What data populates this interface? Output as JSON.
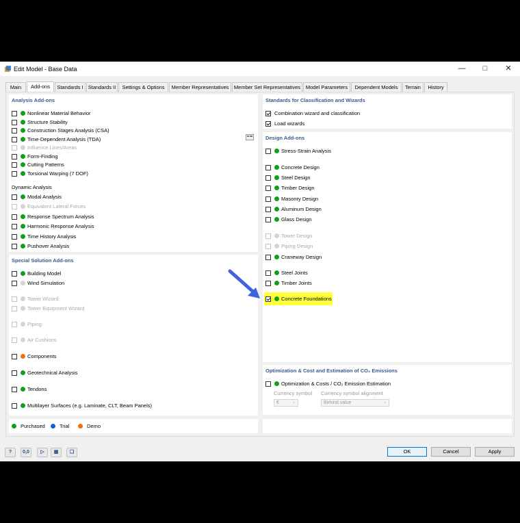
{
  "window": {
    "title": "Edit Model - Base Data"
  },
  "tabs": [
    "Main",
    "Add-ons",
    "Standards I",
    "Standards II",
    "Settings & Options",
    "Member Representatives",
    "Member Set Representatives",
    "Model Parameters",
    "Dependent Models",
    "Terrain",
    "History"
  ],
  "analysis": {
    "title": "Analysis Add-ons",
    "items": [
      {
        "label": "Nonlinear Material Behavior",
        "dot": "green",
        "disabled": false
      },
      {
        "label": "Structure Stability",
        "dot": "green",
        "disabled": false
      },
      {
        "label": "Construction Stages Analysis (CSA)",
        "dot": "green",
        "disabled": false
      },
      {
        "label": "Time-Dependent Analysis (TDA)",
        "dot": "green",
        "disabled": false
      },
      {
        "label": "Influence Lines/Areas",
        "dot": "gray",
        "disabled": true
      },
      {
        "label": "Form-Finding",
        "dot": "green",
        "disabled": false
      },
      {
        "label": "Cutting Patterns",
        "dot": "green",
        "disabled": false
      },
      {
        "label": "Torsional Warping (7 DOF)",
        "dot": "green",
        "disabled": false
      }
    ],
    "dynamic_title": "Dynamic Analysis",
    "dynamic_items": [
      {
        "label": "Modal Analysis",
        "dot": "green",
        "disabled": false
      },
      {
        "label": "Equivalent Lateral Forces",
        "dot": "gray",
        "disabled": true
      },
      {
        "label": "Response Spectrum Analysis",
        "dot": "green",
        "disabled": false
      },
      {
        "label": "Harmonic Response Analysis",
        "dot": "green",
        "disabled": false
      },
      {
        "label": "Time History Analysis",
        "dot": "green",
        "disabled": false
      },
      {
        "label": "Pushover Analysis",
        "dot": "green",
        "disabled": false
      }
    ]
  },
  "special": {
    "title": "Special Solution Add-ons",
    "items": [
      {
        "label": "Building Model",
        "dot": "green",
        "disabled": false
      },
      {
        "label": "Wind Simulation",
        "dot": "gray",
        "disabled": false
      },
      {
        "label": "Tower Wizard",
        "dot": "gray",
        "disabled": true
      },
      {
        "label": "Tower Equipment Wizard",
        "dot": "gray",
        "disabled": true
      },
      {
        "label": "Piping",
        "dot": "gray",
        "disabled": true
      },
      {
        "label": "Air Cushions",
        "dot": "gray",
        "disabled": true
      },
      {
        "label": "Components",
        "dot": "orange",
        "disabled": false
      },
      {
        "label": "Geotechnical Analysis",
        "dot": "green",
        "disabled": false
      },
      {
        "label": "Tendons",
        "dot": "green",
        "disabled": false
      },
      {
        "label": "Multilayer Surfaces (e.g. Laminate, CLT, Beam Panels)",
        "dot": "green",
        "disabled": false
      }
    ]
  },
  "legend": {
    "purchased": "Purchased",
    "trial": "Trial",
    "demo": "Demo"
  },
  "standards": {
    "title": "Standards for Classification and Wizards",
    "items": [
      {
        "label": "Combination wizard and classification",
        "checked": true
      },
      {
        "label": "Load wizards",
        "checked": true
      }
    ]
  },
  "design": {
    "title": "Design Add-ons",
    "items": [
      {
        "label": "Stress-Strain Analysis",
        "dot": "green",
        "disabled": false,
        "checked": false
      },
      {
        "label": "Concrete Design",
        "dot": "green",
        "disabled": false,
        "checked": false
      },
      {
        "label": "Steel Design",
        "dot": "green",
        "disabled": false,
        "checked": false
      },
      {
        "label": "Timber Design",
        "dot": "green",
        "disabled": false,
        "checked": false
      },
      {
        "label": "Masonry Design",
        "dot": "green",
        "disabled": false,
        "checked": false
      },
      {
        "label": "Aluminum Design",
        "dot": "green",
        "disabled": false,
        "checked": false
      },
      {
        "label": "Glass Design",
        "dot": "green",
        "disabled": false,
        "checked": false
      },
      {
        "label": "Tower Design",
        "dot": "gray",
        "disabled": true,
        "checked": false
      },
      {
        "label": "Piping Design",
        "dot": "gray",
        "disabled": true,
        "checked": false
      },
      {
        "label": "Craneway Design",
        "dot": "green",
        "disabled": false,
        "checked": false
      },
      {
        "label": "Steel Joints",
        "dot": "green",
        "disabled": false,
        "checked": false
      },
      {
        "label": "Timber Joints",
        "dot": "green",
        "disabled": false,
        "checked": false
      },
      {
        "label": "Concrete Foundations",
        "dot": "green",
        "disabled": false,
        "checked": true
      }
    ]
  },
  "optimization": {
    "title": "Optimization & Cost and Estimation of CO₂ Emissions",
    "item": "Optimization & Costs / CO₂ Emission Estimation",
    "currency_label": "Currency symbol",
    "currency_value": "€",
    "alignment_label": "Currency symbol alignment",
    "alignment_value": "Behind value"
  },
  "buttons": {
    "ok": "OK",
    "cancel": "Cancel",
    "apply": "Apply"
  },
  "colors": {
    "green": "#12a01a",
    "blue": "#1560e0",
    "orange": "#f07010",
    "highlight": "#ffff3a",
    "arrow": "#3f63e0",
    "section_title": "#3c5a8c"
  }
}
